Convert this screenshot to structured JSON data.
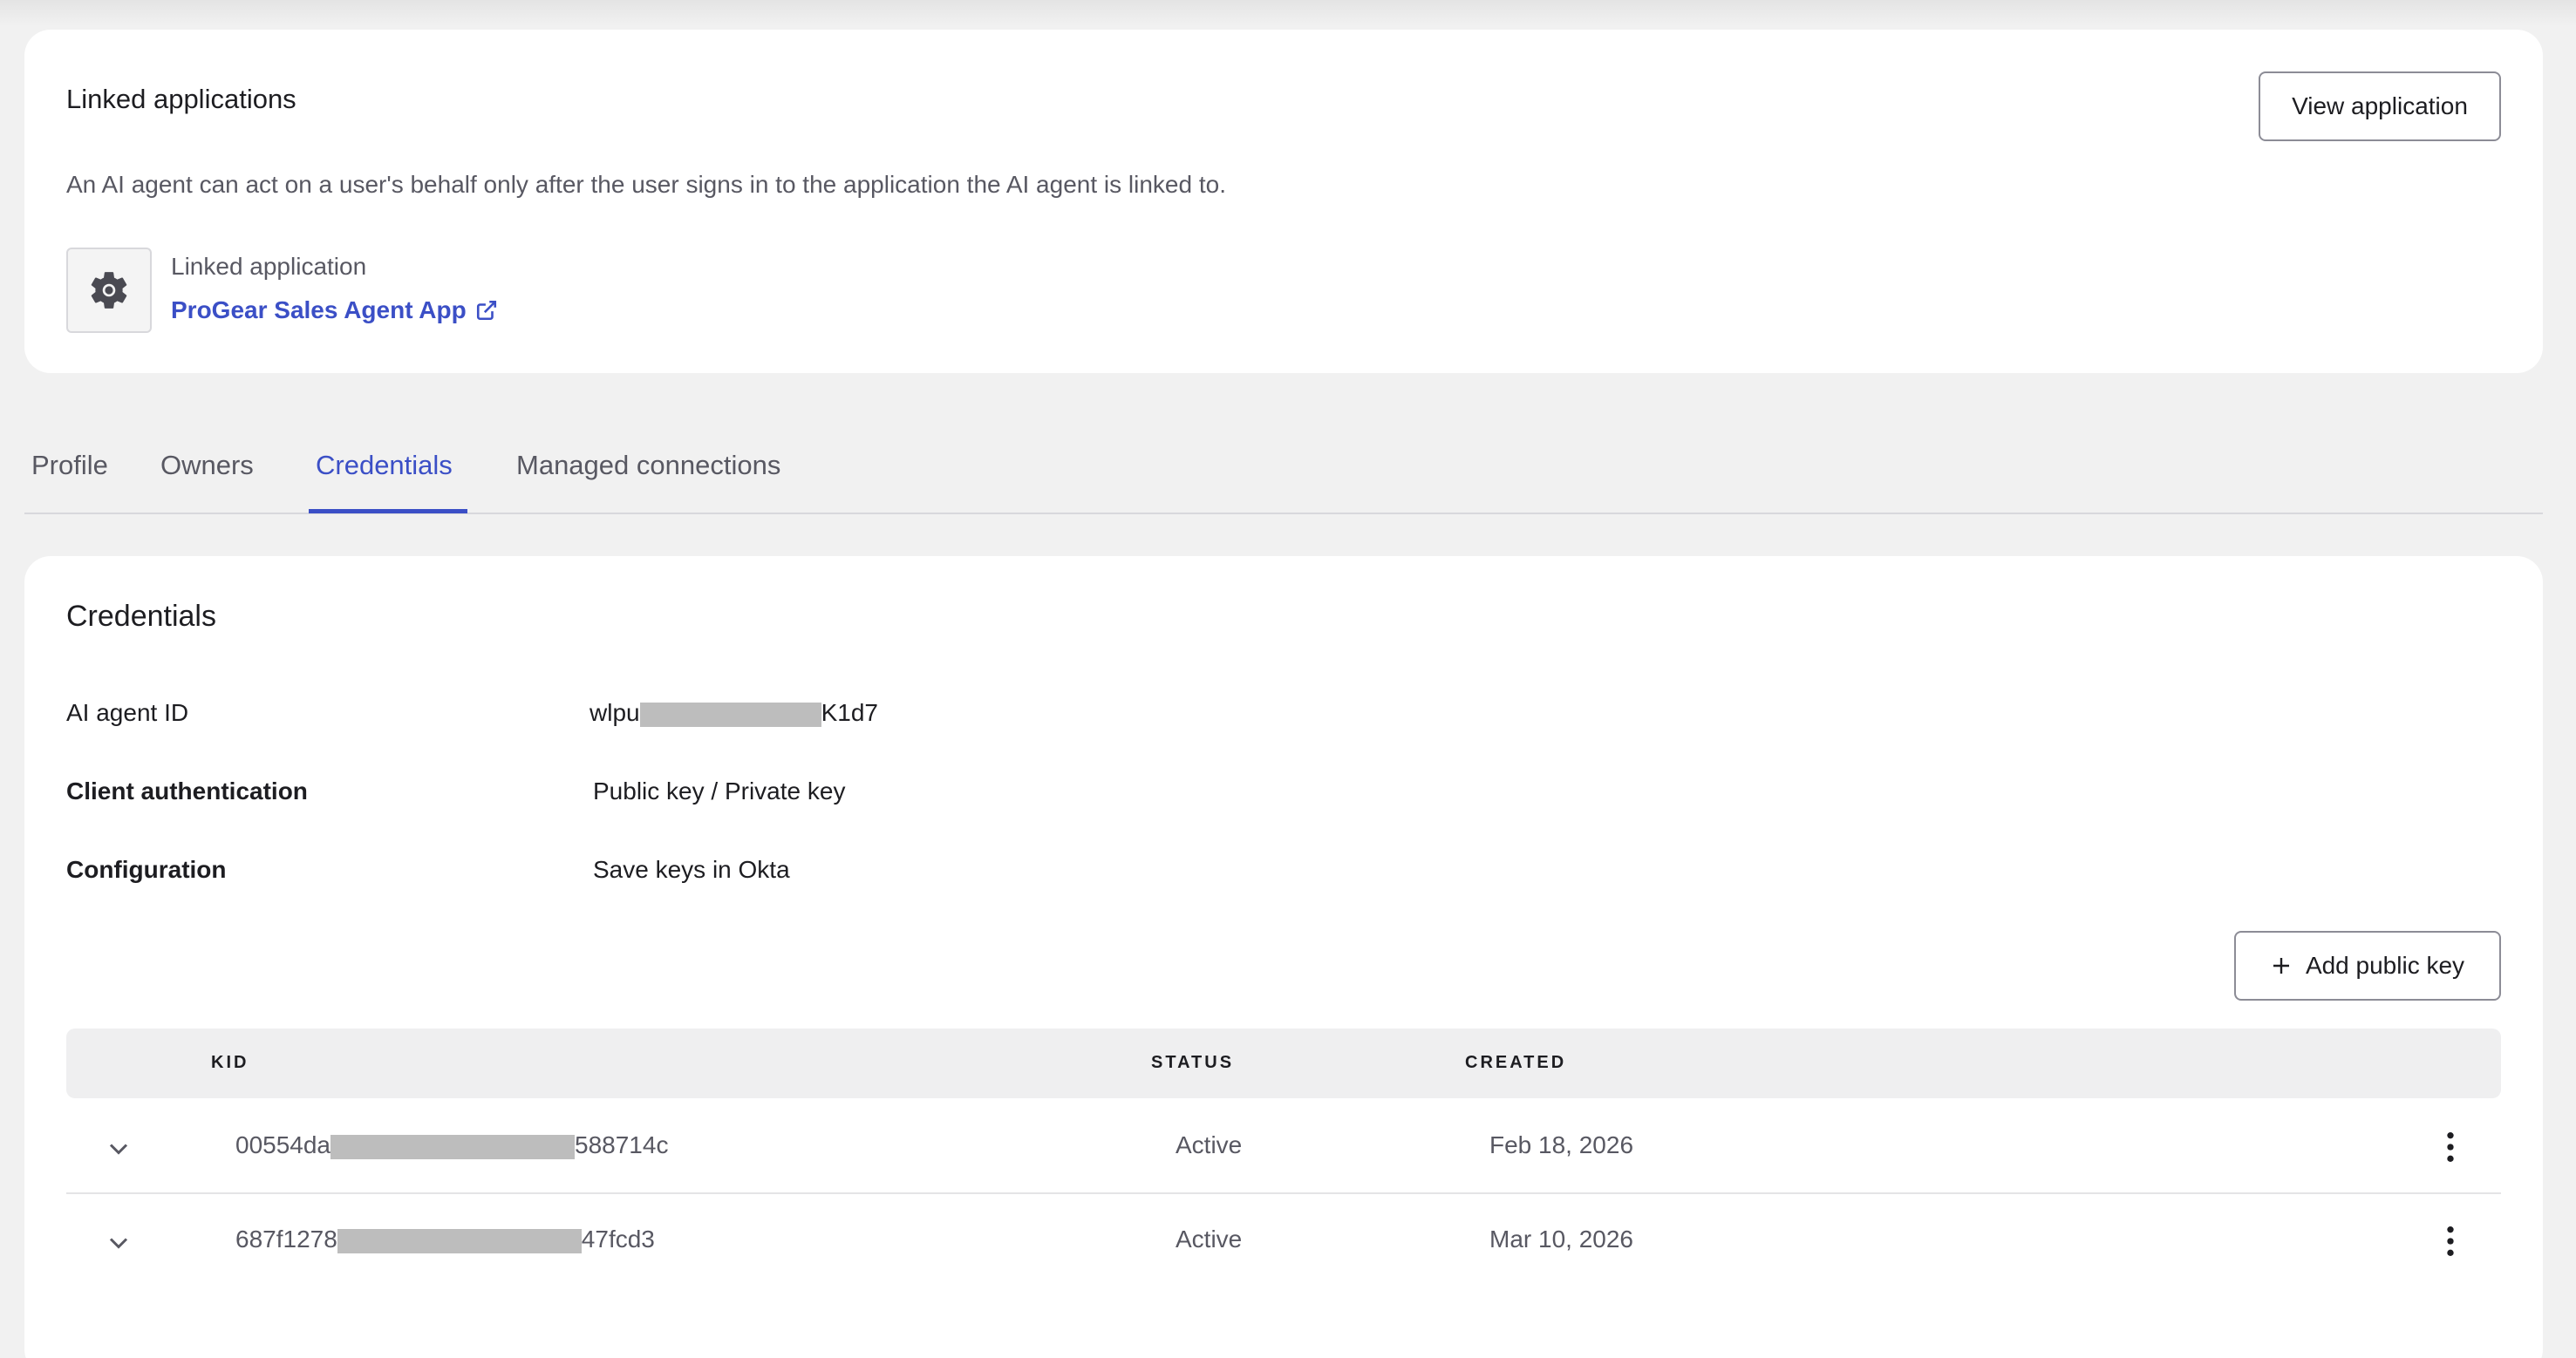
{
  "linked_card": {
    "title": "Linked applications",
    "view_button": "View application",
    "description": "An AI agent can act on a user's behalf only after the user signs in to the application the AI agent is linked to.",
    "linked_label": "Linked application",
    "app_name": "ProGear Sales Agent App",
    "icons": {
      "app": "gear-icon",
      "link": "external-link-icon"
    }
  },
  "tabs": [
    {
      "label": "Profile",
      "active": false
    },
    {
      "label": "Owners",
      "active": false
    },
    {
      "label": "Credentials",
      "active": true
    },
    {
      "label": "Managed connections",
      "active": false
    }
  ],
  "credentials": {
    "title": "Credentials",
    "fields": [
      {
        "label": "AI agent ID",
        "value_prefix": "wlpu",
        "value_suffix": "K1d7"
      },
      {
        "label": "Client authentication",
        "value": "Public key / Private key"
      },
      {
        "label": "Configuration",
        "value": "Save keys in Okta"
      }
    ],
    "add_button": "Add public key",
    "table": {
      "headers": [
        "KID",
        "STATUS",
        "CREATED"
      ],
      "rows": [
        {
          "kid_prefix": "00554da",
          "kid_suffix": "588714c",
          "status": "Active",
          "created": "Feb 18, 2026"
        },
        {
          "kid_prefix": "687f1278",
          "kid_suffix": "47fcd3",
          "status": "Active",
          "created": "Mar 10, 2026"
        }
      ]
    }
  },
  "colors": {
    "accent": "#3b4fc6",
    "background": "#f1f1f1",
    "card": "#ffffff",
    "redaction": "#bdbdbd"
  }
}
